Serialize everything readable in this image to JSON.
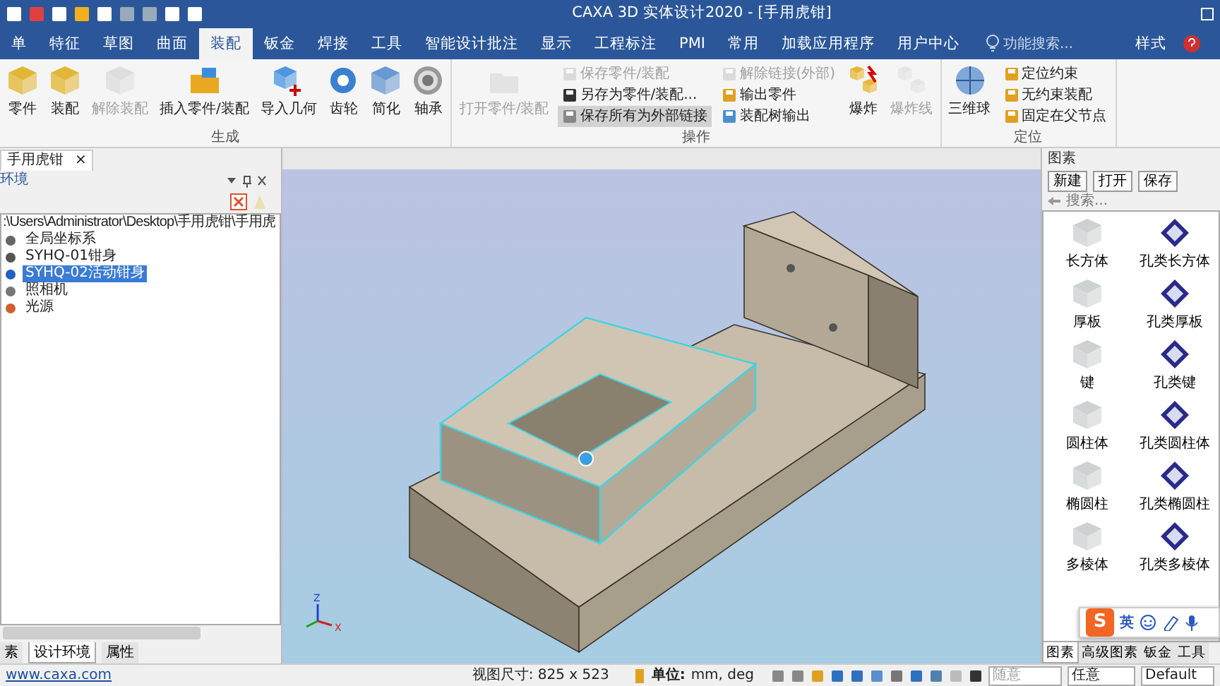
{
  "title_bar": {
    "title": "CAXA 3D 实体设计2020 - [手用虎钳]"
  },
  "menu_tabs": [
    {
      "label": "单",
      "selected": false
    },
    {
      "label": "特征",
      "selected": false
    },
    {
      "label": "草图",
      "selected": false
    },
    {
      "label": "曲面",
      "selected": false
    },
    {
      "label": "装配",
      "selected": true
    },
    {
      "label": "钣金",
      "selected": false
    },
    {
      "label": "焊接",
      "selected": false
    },
    {
      "label": "工具",
      "selected": false
    },
    {
      "label": "智能设计批注",
      "selected": false
    },
    {
      "label": "显示",
      "selected": false
    },
    {
      "label": "工程标注",
      "selected": false
    },
    {
      "label": "PMI",
      "selected": false
    },
    {
      "label": "常用",
      "selected": false
    },
    {
      "label": "加载应用程序",
      "selected": false
    },
    {
      "label": "用户中心",
      "selected": false
    }
  ],
  "feature_search": {
    "placeholder": "功能搜索..."
  },
  "style_menu": {
    "label": "样式"
  },
  "ribbon_groups": [
    {
      "title": "生成",
      "items": [
        {
          "kind": "large",
          "label": "零件",
          "disabled": false
        },
        {
          "kind": "large",
          "label": "装配",
          "disabled": false
        },
        {
          "kind": "large",
          "label": "解除装配",
          "disabled": true
        },
        {
          "kind": "large",
          "label": "插入零件/装配",
          "disabled": false
        },
        {
          "kind": "large",
          "label": "导入几何",
          "disabled": false
        },
        {
          "kind": "large",
          "label": "齿轮",
          "disabled": false
        },
        {
          "kind": "large",
          "label": "简化",
          "disabled": false
        },
        {
          "kind": "large",
          "label": "轴承",
          "disabled": false
        }
      ]
    },
    {
      "title": "操作",
      "items": [
        {
          "kind": "large",
          "label": "打开零件/装配",
          "disabled": true
        },
        {
          "kind": "column",
          "items": [
            {
              "label": "保存零件/装配",
              "disabled": true,
              "highlighted": false
            },
            {
              "label": "另存为零件/装配...",
              "disabled": false,
              "highlighted": false
            },
            {
              "label": "保存所有为外部链接",
              "disabled": false,
              "highlighted": true
            }
          ]
        },
        {
          "kind": "column",
          "items": [
            {
              "label": "解除链接(外部)",
              "disabled": true,
              "highlighted": false
            },
            {
              "label": "输出零件",
              "disabled": false,
              "highlighted": false
            },
            {
              "label": "装配树输出",
              "disabled": false,
              "highlighted": false
            }
          ]
        },
        {
          "kind": "large",
          "label": "爆炸",
          "disabled": false
        },
        {
          "kind": "large",
          "label": "爆炸线",
          "disabled": true
        }
      ]
    },
    {
      "title": "定位",
      "items": [
        {
          "kind": "large",
          "label": "三维球",
          "disabled": false
        },
        {
          "kind": "column",
          "items": [
            {
              "label": "定位约束",
              "disabled": false,
              "highlighted": false
            },
            {
              "label": "无约束装配",
              "disabled": false,
              "highlighted": false
            },
            {
              "label": "固定在父节点",
              "disabled": false,
              "highlighted": false
            }
          ]
        }
      ]
    }
  ],
  "document_tab": {
    "label": "手用虎钳",
    "close": "×"
  },
  "design_panel": {
    "title": "环境",
    "tree": {
      "label": ":\\Users\\Administrator\\Desktop\\手用虎钳\\手用虎",
      "children": [
        {
          "label": "全局坐标系",
          "selected": false
        },
        {
          "label": "SYHQ-01钳身",
          "selected": false
        },
        {
          "label": "SYHQ-02活动钳身",
          "selected": true
        },
        {
          "label": "照相机",
          "selected": false
        },
        {
          "label": "光源",
          "selected": false
        }
      ]
    },
    "tabs": [
      {
        "label": "素",
        "selected": false
      },
      {
        "label": "设计环境",
        "selected": true
      },
      {
        "label": "属性",
        "selected": false
      }
    ]
  },
  "viewport": {
    "triad_labels": [
      "Z",
      "X"
    ]
  },
  "catalog_panel": {
    "title": "图素",
    "buttons": [
      "新建",
      "打开",
      "保存"
    ],
    "search": {
      "placeholder": "搜索..."
    },
    "items": [
      {
        "kind": "solid",
        "label": "长方体"
      },
      {
        "kind": "hole",
        "label": "孔类长方体"
      },
      {
        "kind": "solid",
        "label": "厚板"
      },
      {
        "kind": "hole",
        "label": "孔类厚板"
      },
      {
        "kind": "solid",
        "label": "键"
      },
      {
        "kind": "hole",
        "label": "孔类键"
      },
      {
        "kind": "solid",
        "label": "圆柱体"
      },
      {
        "kind": "hole",
        "label": "孔类圆柱体"
      },
      {
        "kind": "solid",
        "label": "椭圆柱"
      },
      {
        "kind": "hole",
        "label": "孔类椭圆柱"
      },
      {
        "kind": "solid",
        "label": "多棱体"
      },
      {
        "kind": "hole",
        "label": "孔类多棱体"
      }
    ],
    "tabs": [
      {
        "label": "图素",
        "selected": true
      },
      {
        "label": "高级图素",
        "selected": false
      },
      {
        "label": "钣金",
        "selected": false
      },
      {
        "label": "工具",
        "selected": false
      }
    ]
  },
  "ime_toolbar": {
    "logo": "S",
    "mode": "英"
  },
  "status_bar": {
    "link": "www.caxa.com",
    "view_size": "视图尺寸: 825 x 523",
    "unit_label": "单位:",
    "units": "mm, deg",
    "dropdowns": [
      {
        "value": "随意",
        "disabled": true
      },
      {
        "value": "任意",
        "disabled": false
      },
      {
        "value": "Default",
        "disabled": false
      }
    ]
  }
}
